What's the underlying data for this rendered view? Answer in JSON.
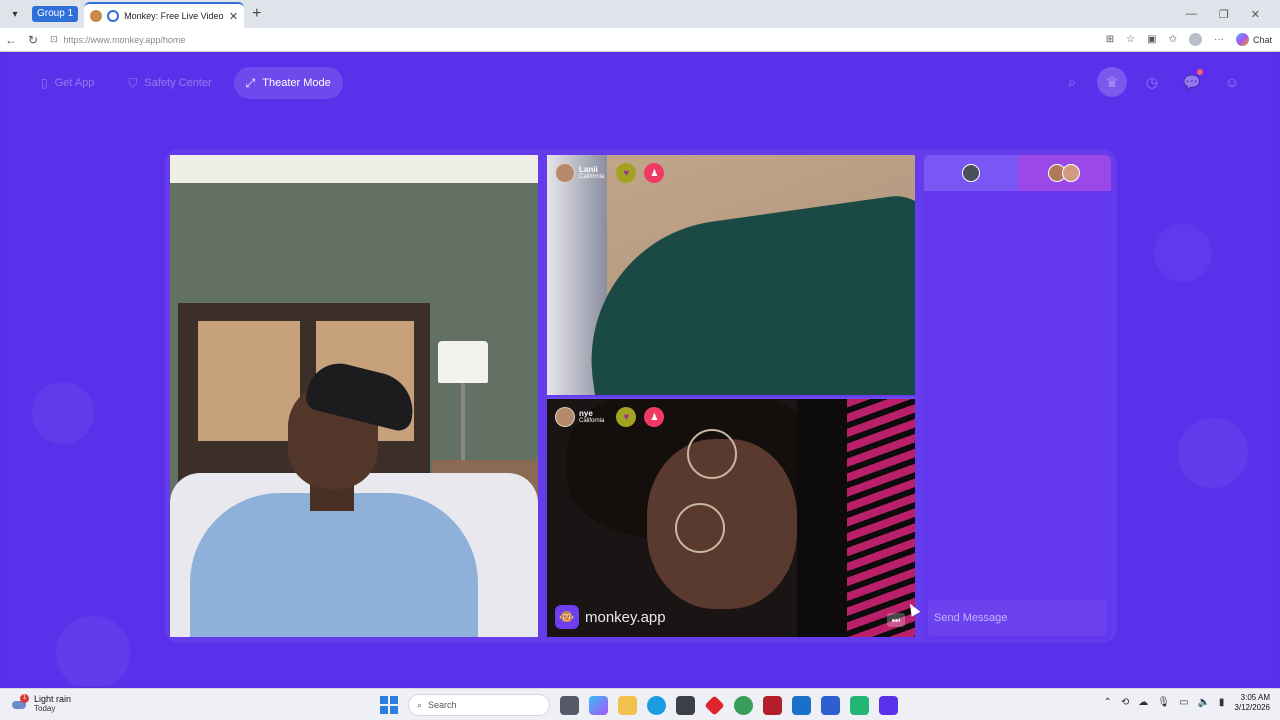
{
  "browser": {
    "group_label": "Group 1",
    "tab_title": "Monkey: Free Live Video Chat",
    "url": "https://www.monkey.app/home",
    "copilot_label": "Chat"
  },
  "nav": {
    "get_app": "Get App",
    "safety_center": "Safety Center",
    "theater_mode": "Theater Mode"
  },
  "participants": [
    {
      "name": "Lanii",
      "location": "California"
    },
    {
      "name": "nye",
      "location": "California"
    }
  ],
  "watermark": "monkey.app",
  "chat": {
    "placeholder": "Send Message"
  },
  "taskbar": {
    "weather_title": "Light rain",
    "weather_sub": "Today",
    "weather_badge": "1",
    "search_placeholder": "Search",
    "time": "3:05 AM",
    "date": "3/12/2026"
  },
  "colors": {
    "app_bg": "#5b30ea",
    "chat_bg": "#6336f0",
    "accent_pink": "#ef3b64",
    "heart_olive": "#a3a321"
  }
}
